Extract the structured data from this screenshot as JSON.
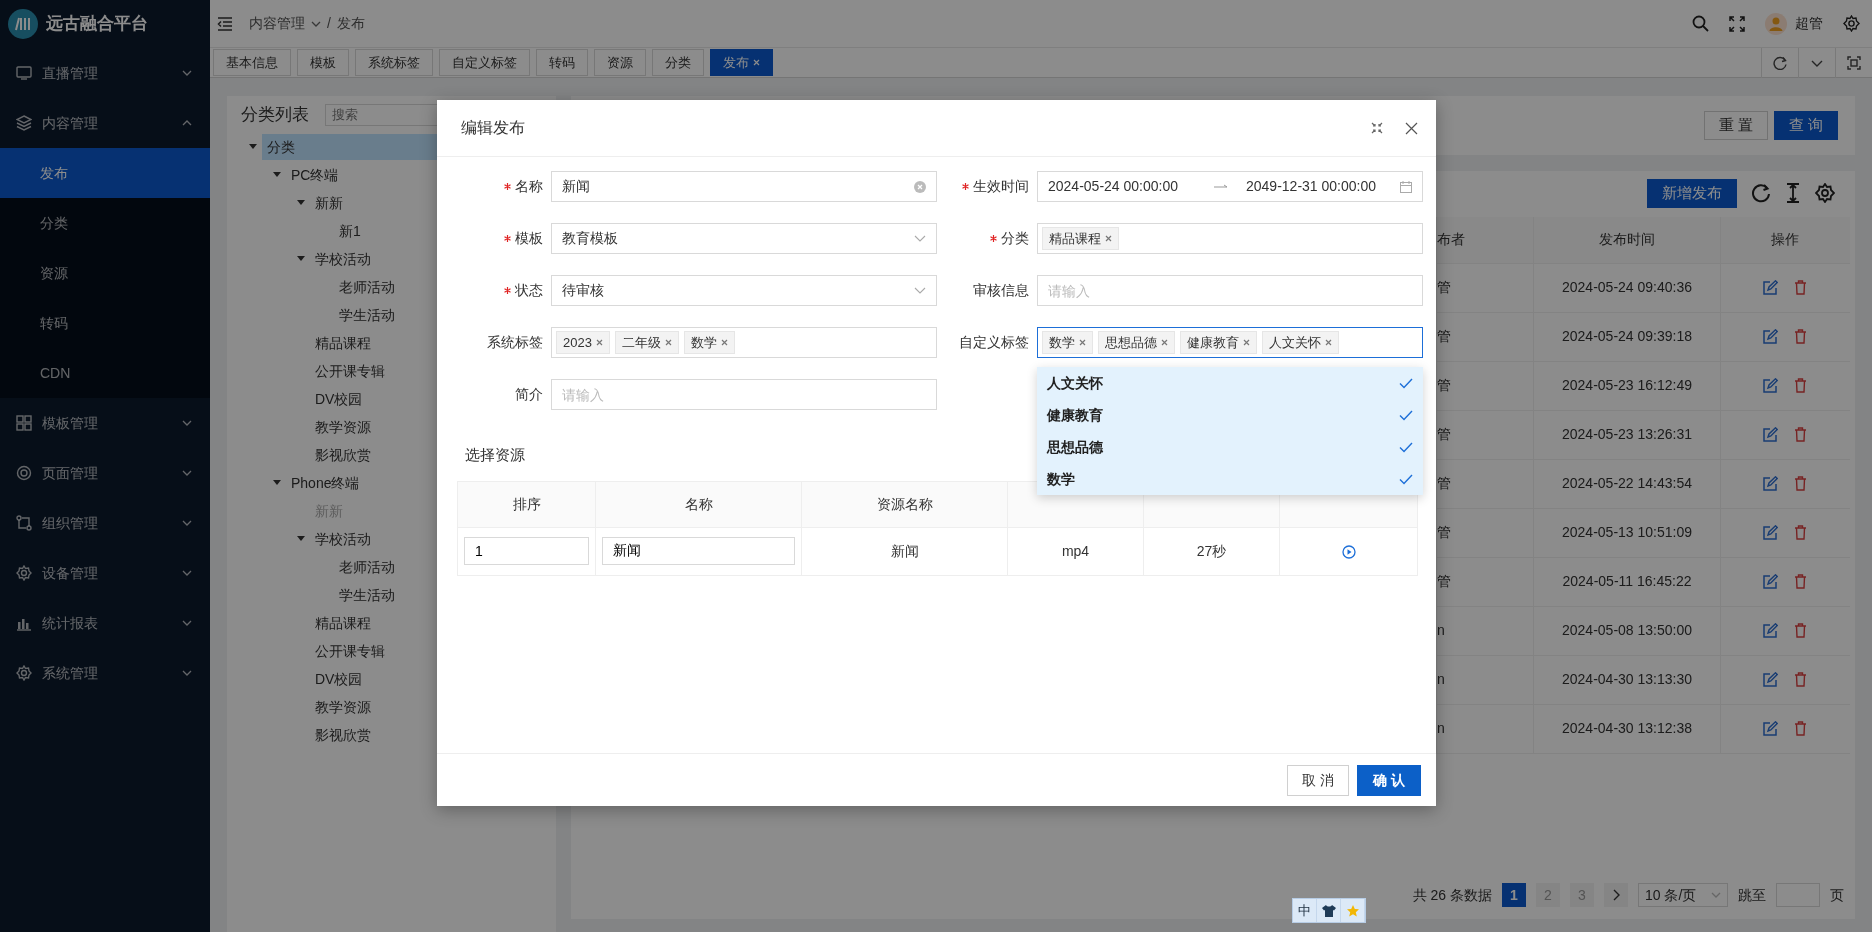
{
  "sidebar": {
    "logo_text": "远古融合平台",
    "items": [
      {
        "label": "直播管理",
        "expanded": false
      },
      {
        "label": "内容管理",
        "expanded": true,
        "children": [
          {
            "label": "发布",
            "selected": true
          },
          {
            "label": "分类",
            "selected": false
          },
          {
            "label": "资源",
            "selected": false
          },
          {
            "label": "转码",
            "selected": false
          },
          {
            "label": "CDN",
            "selected": false
          }
        ]
      },
      {
        "label": "模板管理",
        "expanded": false
      },
      {
        "label": "页面管理",
        "expanded": false
      },
      {
        "label": "组织管理",
        "expanded": false
      },
      {
        "label": "设备管理",
        "expanded": false
      },
      {
        "label": "统计报表",
        "expanded": false
      },
      {
        "label": "系统管理",
        "expanded": false
      }
    ]
  },
  "header": {
    "breadcrumb": [
      "内容管理",
      "发布"
    ],
    "separator": "/",
    "user": "超管"
  },
  "tabs": [
    {
      "label": "基本信息",
      "selected": false
    },
    {
      "label": "模板",
      "selected": false
    },
    {
      "label": "系统标签",
      "selected": false
    },
    {
      "label": "自定义标签",
      "selected": false
    },
    {
      "label": "转码",
      "selected": false
    },
    {
      "label": "资源",
      "selected": false
    },
    {
      "label": "分类",
      "selected": false
    },
    {
      "label": "发布",
      "selected": true
    }
  ],
  "category_panel": {
    "title": "分类列表",
    "search_placeholder": "搜索",
    "tree": [
      {
        "label": "分类",
        "selected": true,
        "disabled": false,
        "expanded": true,
        "children": [
          {
            "label": "PC终端",
            "selected": false,
            "disabled": false,
            "expanded": true,
            "children": [
              {
                "label": "新新",
                "selected": false,
                "disabled": false,
                "expanded": true,
                "children": [
                  {
                    "label": "新1",
                    "selected": false,
                    "disabled": false
                  }
                ]
              },
              {
                "label": "学校活动",
                "selected": false,
                "disabled": false,
                "expanded": true,
                "children": [
                  {
                    "label": "老师活动",
                    "selected": false,
                    "disabled": false
                  },
                  {
                    "label": "学生活动",
                    "selected": false,
                    "disabled": false
                  }
                ]
              },
              {
                "label": "精品课程",
                "selected": false,
                "disabled": false
              },
              {
                "label": "公开课专辑",
                "selected": false,
                "disabled": false
              },
              {
                "label": "DV校园",
                "selected": false,
                "disabled": false
              },
              {
                "label": "教学资源",
                "selected": false,
                "disabled": false
              },
              {
                "label": "影视欣赏",
                "selected": false,
                "disabled": false
              }
            ]
          },
          {
            "label": "Phone终端",
            "selected": false,
            "disabled": false,
            "expanded": true,
            "children": [
              {
                "label": "新新",
                "selected": false,
                "disabled": true
              },
              {
                "label": "学校活动",
                "selected": false,
                "disabled": false,
                "expanded": true,
                "children": [
                  {
                    "label": "老师活动",
                    "selected": false,
                    "disabled": false
                  },
                  {
                    "label": "学生活动",
                    "selected": false,
                    "disabled": false
                  }
                ]
              },
              {
                "label": "精品课程",
                "selected": false,
                "disabled": false
              },
              {
                "label": "公开课专辑",
                "selected": false,
                "disabled": false
              },
              {
                "label": "DV校园",
                "selected": false,
                "disabled": false
              },
              {
                "label": "教学资源",
                "selected": false,
                "disabled": false
              },
              {
                "label": "影视欣赏",
                "selected": false,
                "disabled": false
              }
            ]
          }
        ]
      }
    ]
  },
  "search_card": {
    "buttons": [
      {
        "label": "重 置",
        "kind": "default"
      },
      {
        "label": "查 询",
        "kind": "primary"
      }
    ]
  },
  "publish_table": {
    "add_button": "新增发布",
    "columns": [
      "布者",
      "发布时间",
      "操作"
    ],
    "rows": [
      {
        "publisher": "管",
        "time": "2024-05-24 09:40:36"
      },
      {
        "publisher": "管",
        "time": "2024-05-24 09:39:18"
      },
      {
        "publisher": "管",
        "time": "2024-05-23 16:12:49"
      },
      {
        "publisher": "管",
        "time": "2024-05-23 13:26:31"
      },
      {
        "publisher": "管",
        "time": "2024-05-22 14:43:54"
      },
      {
        "publisher": "管",
        "time": "2024-05-13 10:51:09"
      },
      {
        "publisher": "管",
        "time": "2024-05-11 16:45:22"
      },
      {
        "publisher": "n",
        "time": "2024-05-08 13:50:00"
      },
      {
        "publisher": "n",
        "time": "2024-04-30 13:13:30"
      },
      {
        "publisher": "n",
        "time": "2024-04-30 13:12:38"
      }
    ]
  },
  "pagination": {
    "total": "共 26 条数据",
    "pages": [
      {
        "label": "1",
        "selected": true
      },
      {
        "label": "2",
        "selected": false
      },
      {
        "label": "3",
        "selected": false
      }
    ],
    "page_size": "10 条/页",
    "jump_label": "跳至",
    "page_unit": "页"
  },
  "modal": {
    "title": "编辑发布",
    "fields": [
      {
        "label": "名称",
        "required": true,
        "focused": false,
        "kind": "text",
        "value": "新闻"
      },
      {
        "label": "生效时间",
        "required": true,
        "focused": false,
        "kind": "date_range",
        "start": "2024-05-24 00:00:00",
        "end": "2049-12-31 00:00:00"
      },
      {
        "label": "模板",
        "required": true,
        "focused": false,
        "kind": "select",
        "value": "教育模板"
      },
      {
        "label": "分类",
        "required": true,
        "focused": false,
        "kind": "tags",
        "tags": [
          "精品课程"
        ]
      },
      {
        "label": "状态",
        "required": true,
        "focused": false,
        "kind": "select",
        "value": "待审核"
      },
      {
        "label": "审核信息",
        "required": false,
        "focused": false,
        "kind": "empty",
        "placeholder": "请输入"
      },
      {
        "label": "系统标签",
        "required": false,
        "focused": false,
        "kind": "tags",
        "tags": [
          "2023",
          "二年级",
          "数学"
        ]
      },
      {
        "label": "自定义标签",
        "required": false,
        "focused": true,
        "kind": "tags",
        "tags": [
          "数学",
          "思想品德",
          "健康教育",
          "人文关怀"
        ]
      },
      {
        "label": "简介",
        "required": false,
        "focused": false,
        "kind": "empty",
        "placeholder": "请输入"
      }
    ],
    "dropdown": [
      {
        "label": "人文关怀",
        "selected": true
      },
      {
        "label": "健康教育",
        "selected": true
      },
      {
        "label": "思想品德",
        "selected": true
      },
      {
        "label": "数学",
        "selected": true
      }
    ],
    "section_title": "选择资源",
    "resource_table": {
      "columns": [
        "排序",
        "名称",
        "资源名称"
      ],
      "rows": [
        {
          "order": "1",
          "name": "新闻",
          "resource": "新闻",
          "type": "mp4",
          "duration": "27秒"
        }
      ]
    },
    "buttons": [
      {
        "label": "取 消",
        "kind": "default"
      },
      {
        "label": "确 认",
        "kind": "primary"
      }
    ]
  },
  "ime_bar": {
    "mode": "中"
  }
}
